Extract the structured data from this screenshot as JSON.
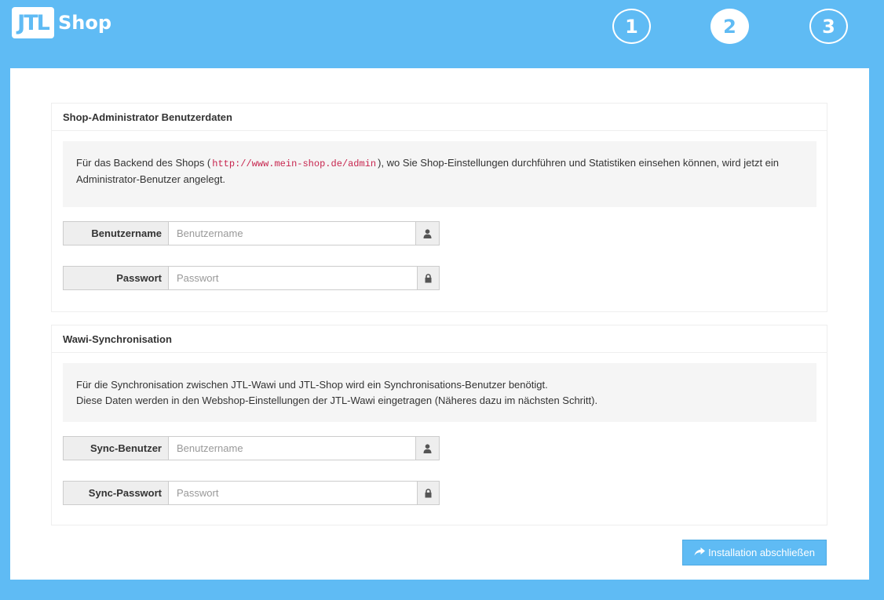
{
  "header": {
    "logo_mark": "JTL",
    "logo_text": "Shop",
    "steps": [
      "1",
      "2",
      "3"
    ],
    "active_step": "2"
  },
  "admin_panel": {
    "title": "Shop-Administrator Benutzerdaten",
    "info_before": "Für das Backend des Shops (",
    "info_code": "http://www.mein-shop.de/admin",
    "info_after": "), wo Sie Shop-Einstellungen durchführen und Statistiken einsehen können, wird jetzt ein Administrator-Benutzer angelegt.",
    "username_label": "Benutzername",
    "username_placeholder": "Benutzername",
    "username_value": "",
    "password_label": "Passwort",
    "password_placeholder": "Passwort",
    "password_value": ""
  },
  "sync_panel": {
    "title": "Wawi-Synchronisation",
    "info_line1": "Für die Synchronisation zwischen JTL-Wawi und JTL-Shop wird ein Synchronisations-Benutzer benötigt.",
    "info_line2": "Diese Daten werden in den Webshop-Einstellungen der JTL-Wawi eingetragen (Näheres dazu im nächsten Schritt).",
    "sync_user_label": "Sync-Benutzer",
    "sync_user_placeholder": "Benutzername",
    "sync_user_value": "",
    "sync_password_label": "Sync-Passwort",
    "sync_password_placeholder": "Passwort",
    "sync_password_value": ""
  },
  "submit": {
    "label": "Installation abschließen"
  },
  "colors": {
    "brand": "#5fbbf4",
    "code": "#c7254e"
  },
  "icons": {
    "user": "user-icon",
    "lock": "lock-icon",
    "share": "share-icon"
  }
}
